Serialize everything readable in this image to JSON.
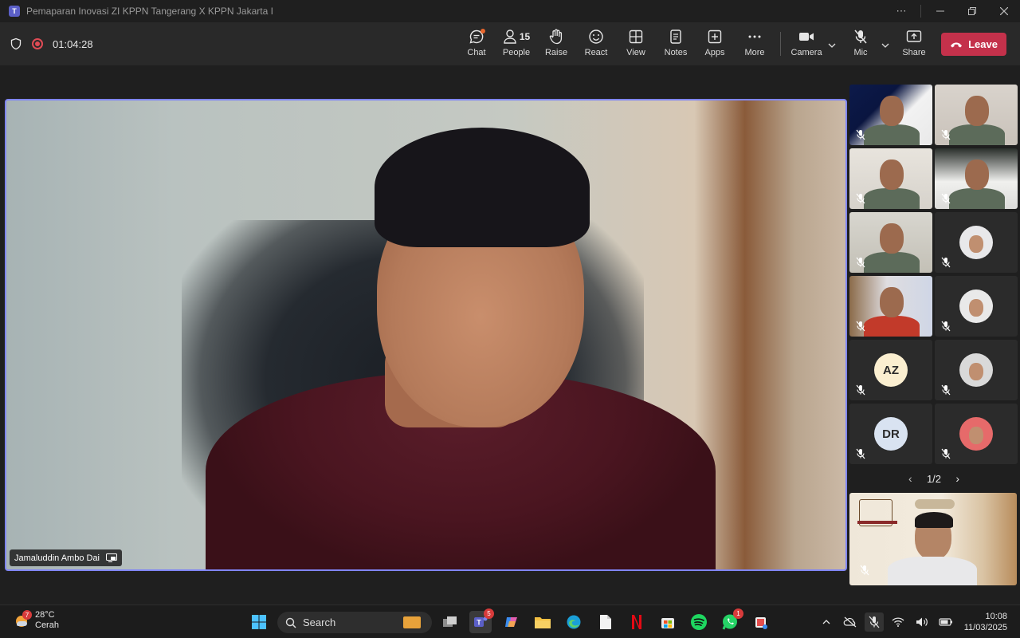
{
  "window": {
    "title": "Pemaparan Inovasi ZI KPPN Tangerang X KPPN Jakarta I",
    "more_label": "⋯"
  },
  "meeting": {
    "timer": "01:04:28",
    "controls": {
      "chat": "Chat",
      "people": "People",
      "people_count": "15",
      "raise": "Raise",
      "react": "React",
      "view": "View",
      "notes": "Notes",
      "apps": "Apps",
      "more": "More",
      "camera": "Camera",
      "mic": "Mic",
      "share": "Share",
      "leave": "Leave"
    }
  },
  "main_speaker": {
    "name": "Jamaluddin Ambo Dai"
  },
  "gallery": {
    "tiles": [
      {
        "initials": "",
        "kind": "video"
      },
      {
        "initials": "",
        "kind": "video"
      },
      {
        "initials": "",
        "kind": "video"
      },
      {
        "initials": "",
        "kind": "video"
      },
      {
        "initials": "",
        "kind": "video"
      },
      {
        "initials": "",
        "kind": "photo"
      },
      {
        "initials": "",
        "kind": "video"
      },
      {
        "initials": "",
        "kind": "photo"
      },
      {
        "initials": "AZ",
        "kind": "initials"
      },
      {
        "initials": "",
        "kind": "photo"
      },
      {
        "initials": "DR",
        "kind": "initials"
      },
      {
        "initials": "",
        "kind": "photo"
      }
    ],
    "pager": "1/2"
  },
  "taskbar": {
    "weather_temp": "28°C",
    "weather_desc": "Cerah",
    "weather_badge": "7",
    "search_label": "Search",
    "teams_badge": "5",
    "whatsapp_badge": "1",
    "time": "10:08",
    "date": "11/03/2025"
  },
  "colors": {
    "accent": "#7f85f5",
    "leave": "#c4314b",
    "recording": "#e04b55"
  }
}
